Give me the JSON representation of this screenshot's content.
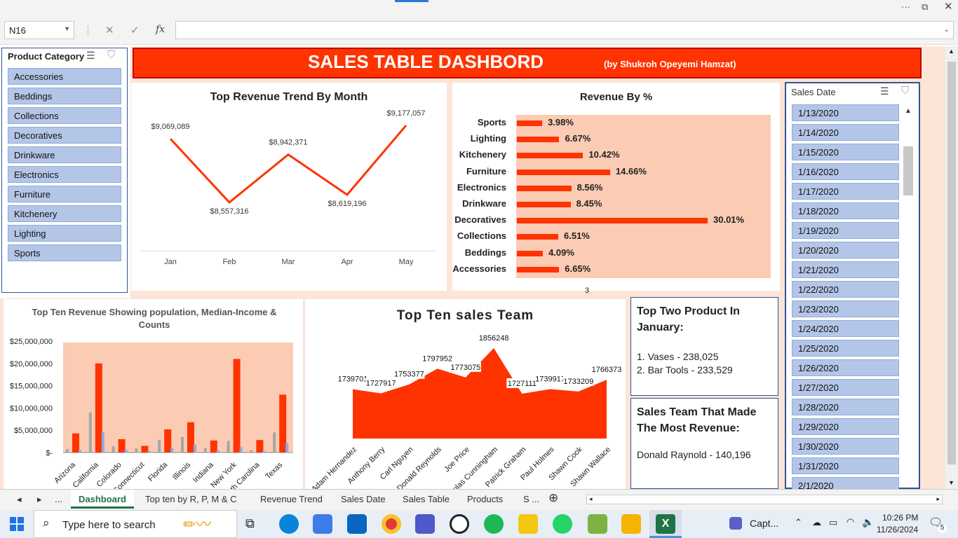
{
  "formula": {
    "name_box": "N16"
  },
  "banner": {
    "title": "SALES TABLE DASHBORD",
    "author": "(by Shukroh Opeyemi Hamzat)"
  },
  "product_slicer": {
    "title": "Product Category",
    "items": [
      "Accessories",
      "Beddings",
      "Collections",
      "Decoratives",
      "Drinkware",
      "Electronics",
      "Furniture",
      "Kitchenery",
      "Lighting",
      "Sports"
    ]
  },
  "date_slicer": {
    "title": "Sales Date",
    "items": [
      "1/13/2020",
      "1/14/2020",
      "1/15/2020",
      "1/16/2020",
      "1/17/2020",
      "1/18/2020",
      "1/19/2020",
      "1/20/2020",
      "1/21/2020",
      "1/22/2020",
      "1/23/2020",
      "1/24/2020",
      "1/25/2020",
      "1/26/2020",
      "1/27/2020",
      "1/28/2020",
      "1/29/2020",
      "1/30/2020",
      "1/31/2020",
      "2/1/2020"
    ]
  },
  "chart_data": [
    {
      "type": "line",
      "title": "Top Revenue Trend By Month",
      "categories": [
        "Jan",
        "Feb",
        "Mar",
        "Apr",
        "May"
      ],
      "values": [
        9069089,
        8557316,
        8942371,
        8619196,
        9177057
      ],
      "labels": [
        "$9,069,089",
        "$8,557,316",
        "$8,942,371",
        "$8,619,196",
        "$9,177,057"
      ],
      "color": "#ff3300"
    },
    {
      "type": "bar",
      "title": "Revenue By %",
      "categories": [
        "Sports",
        "Lighting",
        "Kitchenery",
        "Furniture",
        "Electronics",
        "Drinkware",
        "Decoratives",
        "Collections",
        "Beddings",
        "Accessories"
      ],
      "values": [
        3.98,
        6.67,
        10.42,
        14.66,
        8.56,
        8.45,
        30.01,
        6.51,
        4.09,
        6.65
      ],
      "labels": [
        "3.98%",
        "6.67%",
        "10.42%",
        "14.66%",
        "8.56%",
        "8.45%",
        "30.01%",
        "6.51%",
        "4.09%",
        "6.65%"
      ],
      "color": "#ff3300"
    },
    {
      "type": "bar",
      "title": "Top Ten Revenue Showing population, Median-Income & Counts",
      "categories": [
        "Arizona",
        "California",
        "Colorado",
        "Connecticut",
        "Florida",
        "Illinois",
        "Indiana",
        "New York",
        "North Carolina",
        "Texas"
      ],
      "series": [
        {
          "values": [
            800000,
            9000000,
            1400000,
            900000,
            2800000,
            3500000,
            1000000,
            2600000,
            500000,
            4500000
          ],
          "color": "#a5a5a5"
        },
        {
          "values": [
            4300000,
            20000000,
            3000000,
            1500000,
            5200000,
            6800000,
            2700000,
            21000000,
            2800000,
            13000000
          ],
          "color": "#ff3300"
        },
        {
          "values": [
            600000,
            4500000,
            700000,
            400000,
            1100000,
            1800000,
            500000,
            1300000,
            400000,
            2100000
          ],
          "color": "#8faadc"
        }
      ],
      "ylim": [
        0,
        25000000
      ],
      "yticks": [
        "$25,000,000",
        "$20,000,000",
        "$15,000,000",
        "$10,000,000",
        "$5,000,000",
        "$-"
      ]
    },
    {
      "type": "area",
      "title": "Top Ten sales Team",
      "categories": [
        "Adam Hernandez",
        "Anthony Berry",
        "Carl Nguyen",
        "Donald Reynolds",
        "Joe Price",
        "Nicolas Cunningham",
        "Patrick Graham",
        "Paul Holmes",
        "Shawn Cook",
        "Shawn Wallace"
      ],
      "values": [
        1739701,
        1727917,
        1753377,
        1797952,
        1773075,
        1856248,
        1727111,
        1739917,
        1733209,
        1766373
      ],
      "labels": [
        "1739701",
        "1727917",
        "1753377",
        "1797952",
        "1773075",
        "1856248",
        "1727111",
        "1739917",
        "1733209",
        "1766373"
      ],
      "color": "#ff3300"
    }
  ],
  "top_product": {
    "title": "Top Two Product In January:",
    "line1": "1. Vases - 238,025",
    "line2": "2. Bar Tools - 233,529"
  },
  "top_team": {
    "title": "Sales Team That Made The Most Revenue:",
    "value": "Donald Raynold - 140,196"
  },
  "stray_label": "3",
  "tabs": [
    "Dashboard",
    "Top ten by R, P, M & C",
    "Revenue Trend",
    "Sales Date",
    "Sales Table",
    "Products",
    "S ..."
  ],
  "taskbar": {
    "search": "Type here to search",
    "time": "10:26 PM",
    "date": "11/26/2024",
    "capture": "Capt...",
    "notif": "5"
  }
}
